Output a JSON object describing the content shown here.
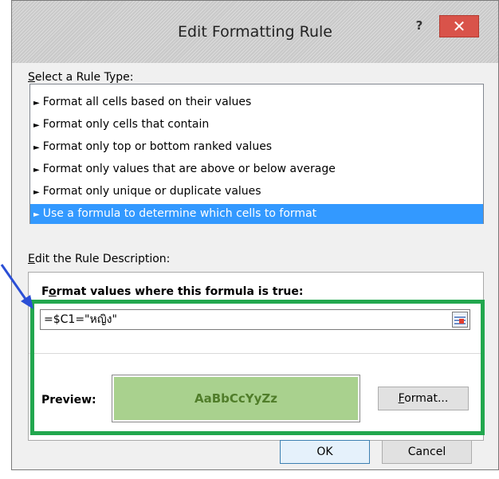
{
  "dialog": {
    "title": "Edit Formatting Rule",
    "help_label": "?",
    "close_label": "✕"
  },
  "rule_type": {
    "label_mnemonic": "S",
    "label_rest": "elect a Rule Type:",
    "items": [
      {
        "label": "Format all cells based on their values",
        "selected": false
      },
      {
        "label": "Format only cells that contain",
        "selected": false
      },
      {
        "label": "Format only top or bottom ranked values",
        "selected": false
      },
      {
        "label": "Format only values that are above or below average",
        "selected": false
      },
      {
        "label": "Format only unique or duplicate values",
        "selected": false
      },
      {
        "label": "Use a formula to determine which cells to format",
        "selected": true
      }
    ],
    "pointer_glyph": "►"
  },
  "description": {
    "label_mnemonic": "E",
    "label_rest": "dit the Rule Description:",
    "formula_label_start": "F",
    "formula_label_mnemonic": "o",
    "formula_label_rest": "rmat values where this formula is true:",
    "formula_value": "=$C1=\"หญิง\"",
    "preview_label": "Preview:",
    "preview_text": "AaBbCcYyZz",
    "format_button_mnemonic": "F",
    "format_button_rest": "ormat..."
  },
  "footer": {
    "ok_label": "OK",
    "cancel_label": "Cancel"
  },
  "colors": {
    "selection": "#3399ff",
    "preview_fill": "#a9d18e",
    "preview_text": "#507d2a",
    "highlight_border": "#22a74e",
    "close_button": "#d9534a",
    "arrow": "#2b4fd6"
  }
}
